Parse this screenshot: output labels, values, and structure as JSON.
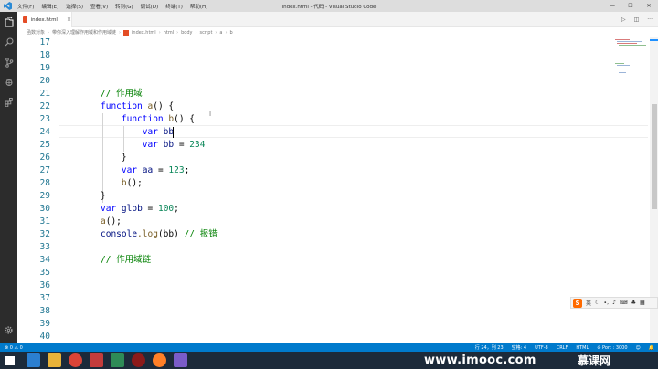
{
  "window": {
    "title": "index.html - 代码 - Visual Studio Code",
    "menu": [
      "文件(F)",
      "编辑(E)",
      "选择(S)",
      "查看(V)",
      "转到(G)",
      "调试(D)",
      "终端(T)",
      "帮助(H)"
    ],
    "controls": [
      "—",
      "☐",
      "✕"
    ]
  },
  "tab": {
    "filename": "index.html",
    "close": "×"
  },
  "breadcrumb": [
    "函数对象",
    "带你深入理解作用域和作用域链",
    "index.html",
    "html",
    "body",
    "script",
    "a",
    "b"
  ],
  "editor": {
    "lines": [
      {
        "n": "17"
      },
      {
        "n": "18"
      },
      {
        "n": "19"
      },
      {
        "n": "20"
      },
      {
        "n": "21"
      },
      {
        "n": "22"
      },
      {
        "n": "23"
      },
      {
        "n": "24"
      },
      {
        "n": "25"
      },
      {
        "n": "26"
      },
      {
        "n": "27"
      },
      {
        "n": "28"
      },
      {
        "n": "29"
      },
      {
        "n": "30"
      },
      {
        "n": "31"
      },
      {
        "n": "32"
      },
      {
        "n": "33"
      },
      {
        "n": "34"
      },
      {
        "n": "35"
      },
      {
        "n": "36"
      },
      {
        "n": "37"
      },
      {
        "n": "38"
      },
      {
        "n": "39"
      },
      {
        "n": "40"
      }
    ],
    "code": {
      "l21_comment": "// 作用域",
      "kw_function": "function",
      "fn_a": "a",
      "fn_b": "b",
      "paren_brace": "() {",
      "kw_var": "var",
      "var_bb": "bb",
      "op_eq": " = ",
      "num_234": "234",
      "close_brace": "}",
      "var_aa": "aa",
      "num_123": "123",
      "semi": ";",
      "call_b": "();",
      "var_glob": "glob",
      "num_100": "100",
      "call_a": "();",
      "console": "console",
      "dot_log": ".log",
      "log_args": "(bb) ",
      "comment_err": "// 报错",
      "l34_comment": "// 作用域链"
    }
  },
  "ime": {
    "logo": "S",
    "label": "英"
  },
  "status": {
    "errors": "⊗ 0 ⚠ 0",
    "position": "行 24，列 23",
    "spaces": "空格: 4",
    "encoding": "UTF-8",
    "eol": "CRLF",
    "language": "HTML",
    "port": "⊘ Port : 3000",
    "feedback": "☺",
    "bell": "🔔"
  },
  "watermark": {
    "site": "www.imooc.com",
    "logo": "慕课网"
  },
  "colors": {
    "statusbar": "#007acc",
    "activitybar": "#2c2c2c",
    "keyword": "#0000ff",
    "comment": "#008000",
    "number": "#098658"
  }
}
